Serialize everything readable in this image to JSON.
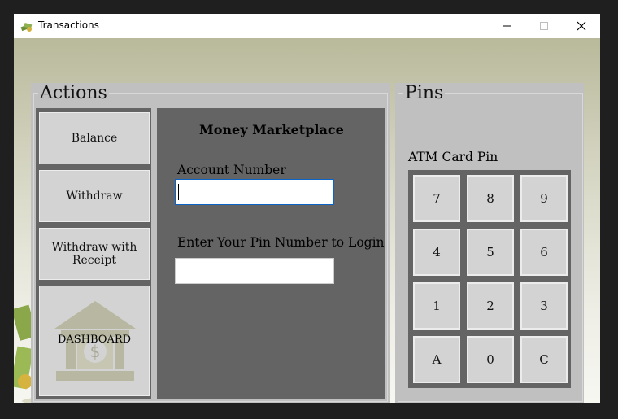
{
  "window": {
    "title": "Transactions"
  },
  "actions": {
    "group_title": "Actions",
    "buttons": {
      "balance": "Balance",
      "withdraw": "Withdraw",
      "withdraw_receipt": "Withdraw with Receipt"
    },
    "dashboard_label": "DASHBOARD"
  },
  "form": {
    "title": "Money Marketplace",
    "account_label": "Account Number",
    "account_value": "",
    "pin_label": "Enter Your Pin Number to Login",
    "pin_value": ""
  },
  "pins": {
    "group_title": "Pins",
    "keypad_label": "ATM Card Pin",
    "keys": [
      "7",
      "8",
      "9",
      "4",
      "5",
      "6",
      "1",
      "2",
      "3",
      "A",
      "0",
      "C"
    ]
  }
}
